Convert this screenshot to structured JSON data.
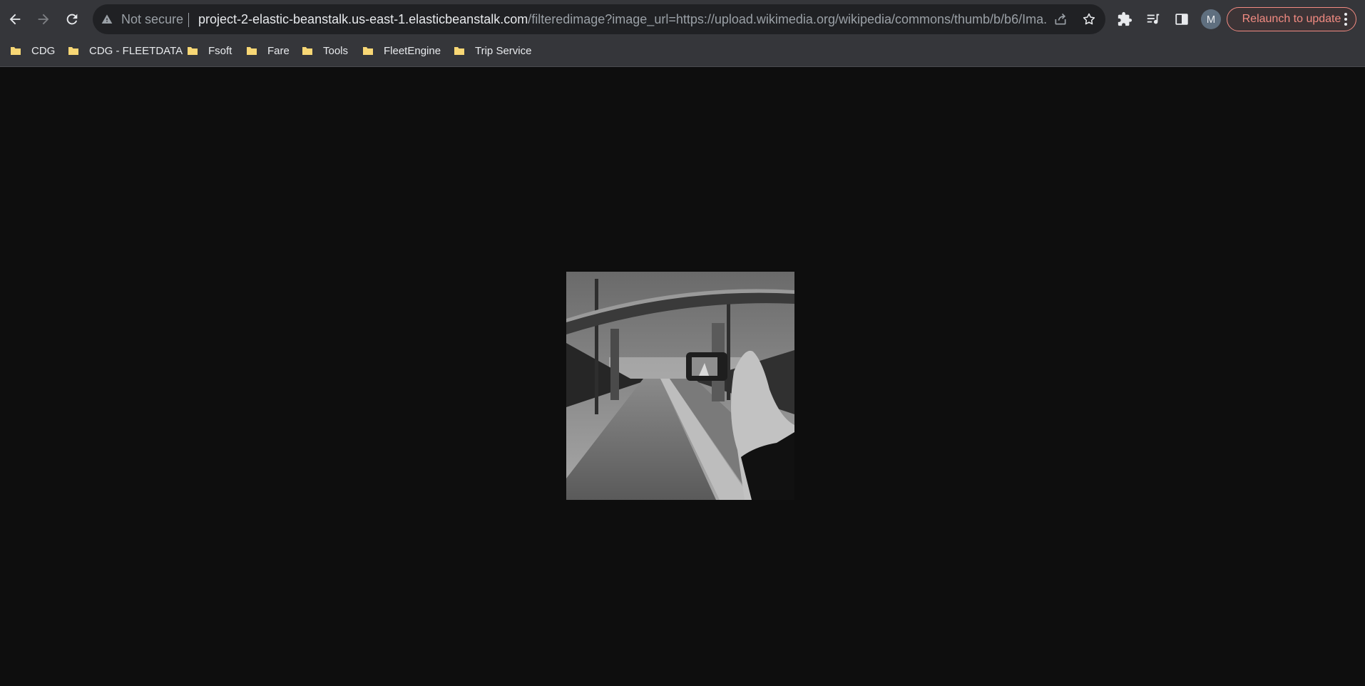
{
  "browser": {
    "security_label": "Not secure",
    "url_host": "project-2-elastic-beanstalk.us-east-1.elasticbeanstalk.com",
    "url_path": "/filteredimage?image_url=https://upload.wikimedia.org/wikipedia/commons/thumb/b/b6/Ima...",
    "profile_initial": "M",
    "relaunch_label": "Relaunch to update",
    "relaunch_color": "#f28b82"
  },
  "bookmarks": [
    {
      "label": "CDG"
    },
    {
      "label": "CDG - FLEETDATA"
    },
    {
      "label": "Fsoft"
    },
    {
      "label": "Fare"
    },
    {
      "label": "Tools"
    },
    {
      "label": "FleetEngine"
    },
    {
      "label": "Trip Service"
    }
  ],
  "icons": {
    "back": "arrow-left",
    "forward": "arrow-right",
    "reload": "reload",
    "warning": "warning-triangle",
    "share": "share",
    "bookmark": "star",
    "extensions": "puzzle",
    "media": "media-queue",
    "side_panel": "side-panel",
    "menu": "vertical-dots",
    "folder": "folder"
  },
  "colors": {
    "folder": "#f8d775",
    "page_background": "#0e0e0e",
    "toolbar": "#35363a",
    "omnibox": "#202124"
  }
}
